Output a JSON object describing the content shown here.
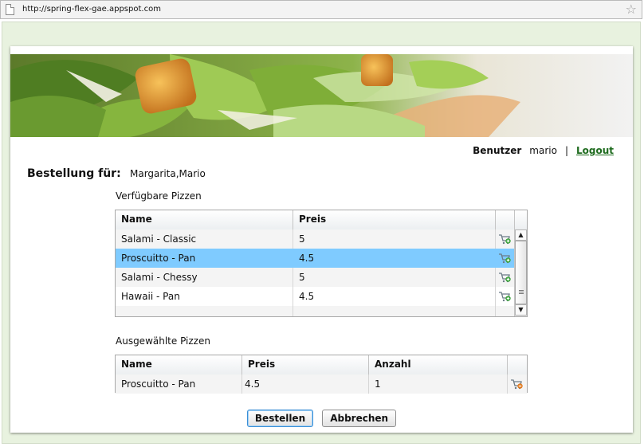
{
  "browser": {
    "url": "http://spring-flex-gae.appspot.com"
  },
  "user_bar": {
    "label": "Benutzer",
    "username": "mario",
    "separator": "|",
    "logout": "Logout"
  },
  "order": {
    "label": "Bestellung für:",
    "customer": "Margarita,Mario"
  },
  "available": {
    "title": "Verfügbare Pizzen",
    "columns": [
      "Name",
      "Preis"
    ],
    "rows": [
      {
        "name": "Salami - Classic",
        "price": "5"
      },
      {
        "name": "Proscuitto - Pan",
        "price": "4.5",
        "selected": true
      },
      {
        "name": "Salami - Chessy",
        "price": "5"
      },
      {
        "name": "Hawaii - Pan",
        "price": "4.5"
      }
    ],
    "row_action_icon": "add-to-cart-icon"
  },
  "selected": {
    "title": "Ausgewählte Pizzen",
    "columns": [
      "Name",
      "Preis",
      "Anzahl"
    ],
    "rows": [
      {
        "name": "Proscuitto - Pan",
        "price": "4.5",
        "quantity": "1"
      }
    ],
    "row_action_icon": "remove-from-cart-icon"
  },
  "actions": {
    "order": "Bestellen",
    "cancel": "Abbrechen"
  },
  "colors": {
    "app_background": "#e8f2df",
    "selected_row": "#7fcbff",
    "logout_link": "#1e6b1e"
  }
}
